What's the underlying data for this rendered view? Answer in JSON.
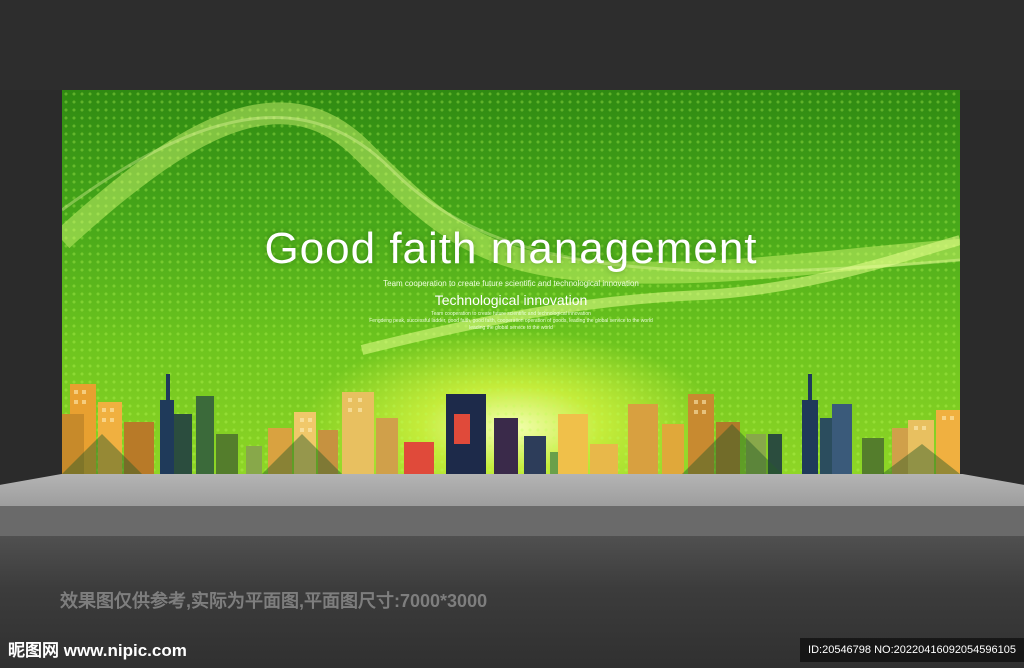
{
  "board": {
    "title": "Good faith management",
    "subtitle_small": "Team cooperation to create future scientific and technological innovation",
    "subtitle_main": "Technological innovation",
    "tagline_line1": "Team cooperation to create future scientific and technological innovation",
    "tagline_line2": "Fengdeng peak, successful ladder, good faith, good faith, cooperation operation of goods, leading the global service to the world",
    "tagline_line3": "leading the global service to the world"
  },
  "caption": "效果图仅供参考,实际为平面图,平面图尺寸:7000*3000",
  "watermark": {
    "logo": "昵图网 www.nipic.com",
    "id_text": "ID:20546798 NO:20220416092054596105"
  },
  "colors": {
    "board_green": "#48a81a",
    "wall": "#2b2b2b",
    "stage": "#a8a8a8"
  }
}
